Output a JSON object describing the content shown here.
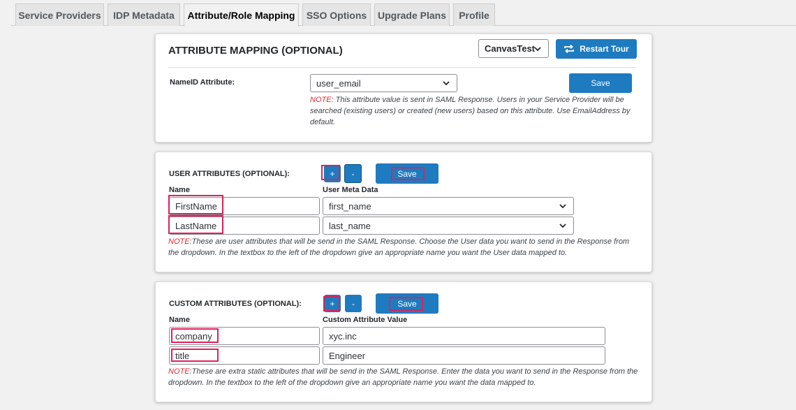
{
  "tabs": [
    {
      "label": "Service Providers"
    },
    {
      "label": "IDP Metadata"
    },
    {
      "label": "Attribute/Role Mapping"
    },
    {
      "label": "SSO Options"
    },
    {
      "label": "Upgrade Plans"
    },
    {
      "label": "Profile"
    }
  ],
  "attribute_mapping": {
    "title": "ATTRIBUTE MAPPING (OPTIONAL)",
    "sp_select": "CanvasTest",
    "restart_tour_label": "Restart Tour",
    "nameid_label": "NameID Attribute:",
    "nameid_select": "user_email",
    "save_label": "Save",
    "note_prefix": "NOTE:",
    "note_text": " This attribute value is sent in SAML Response. Users in your Service Provider will be searched (existing users) or created (new users) based on this attribute. Use EmailAddress by default."
  },
  "user_attributes": {
    "title": "USER ATTRIBUTES (OPTIONAL):",
    "add_label": "+",
    "remove_label": "-",
    "save_label": "Save",
    "col_name": "Name",
    "col_value": "User Meta Data",
    "rows": [
      {
        "name": "FirstName",
        "value": "first_name"
      },
      {
        "name": "LastName",
        "value": "last_name"
      }
    ],
    "note_prefix": "NOTE:",
    "note_text": "These are user attributes that will be send in the SAML Response. Choose the User data you want to send in the Response from the dropdown. In the textbox to the left of the dropdown give an appropriate name you want the User data mapped to."
  },
  "custom_attributes": {
    "title": "CUSTOM ATTRIBUTES (OPTIONAL):",
    "add_label": "+",
    "remove_label": "-",
    "save_label": "Save",
    "col_name": "Name",
    "col_value": "Custom Attribute Value",
    "rows": [
      {
        "name": "company",
        "value": "xyc.inc"
      },
      {
        "name": "title",
        "value": "Engineer"
      }
    ],
    "note_prefix": "NOTE:",
    "note_text": "These are extra static attributes that will be send in the SAML Response. Enter the data you want to send in the Response from the dropdown. In the textbox to the left of the dropdown give an appropriate name you want the data mapped to."
  },
  "colors": {
    "primary_button": "#1e7bbf",
    "highlight": "#e0205a",
    "note_red": "#e0282e"
  }
}
